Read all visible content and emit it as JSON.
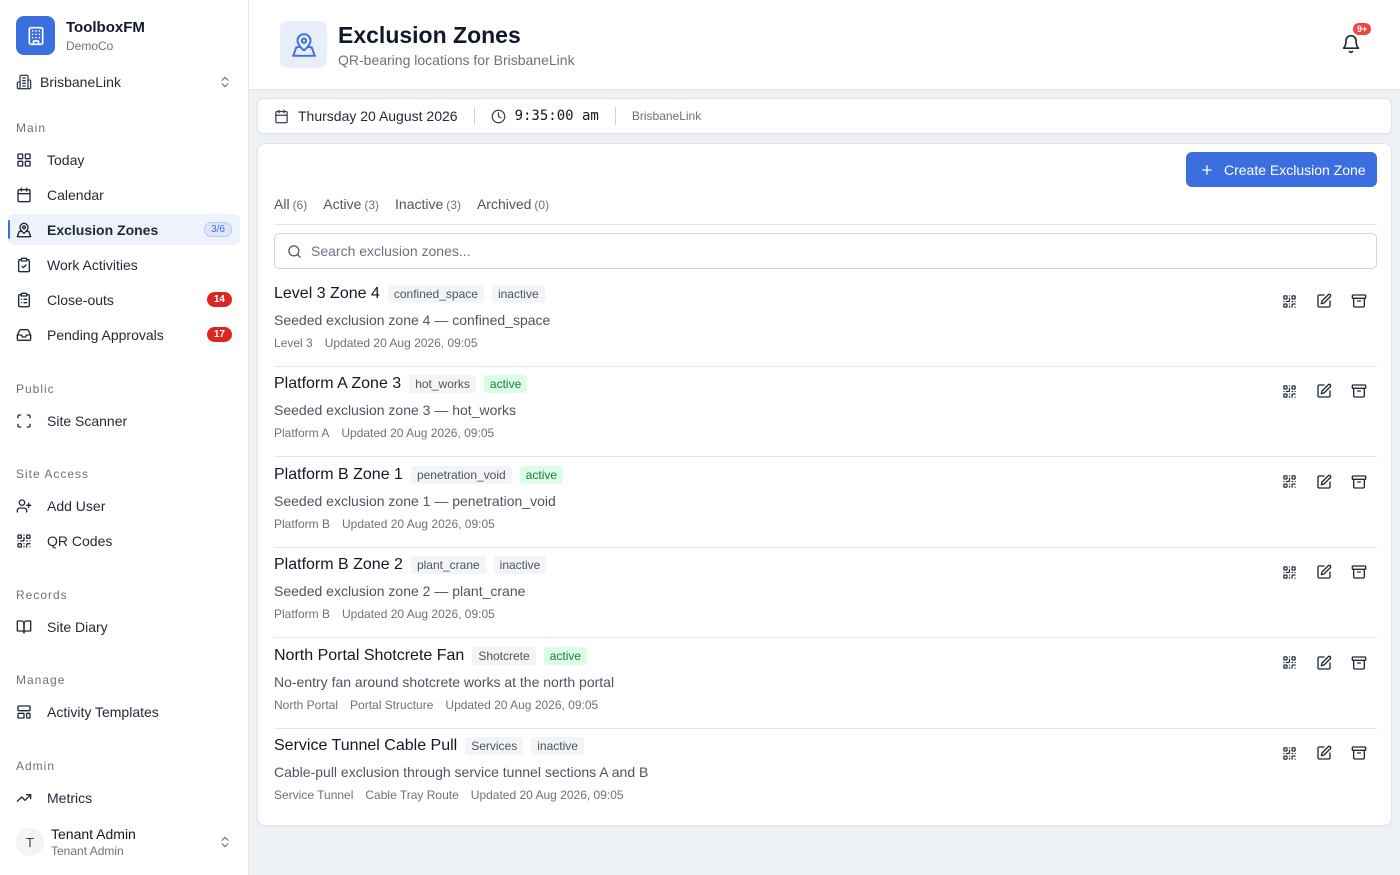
{
  "brand": {
    "name": "ToolboxFM",
    "org": "DemoCo"
  },
  "site_selector": {
    "value": "BrisbaneLink"
  },
  "nav": {
    "sections": [
      {
        "title": "Main"
      },
      {
        "title": "Public"
      },
      {
        "title": "Site Access"
      },
      {
        "title": "Records"
      },
      {
        "title": "Manage"
      },
      {
        "title": "Admin"
      }
    ],
    "items": [
      {
        "label": "Today",
        "icon": "grid-icon"
      },
      {
        "label": "Calendar",
        "icon": "calendar-icon"
      },
      {
        "label": "Exclusion Zones",
        "icon": "location-user-icon",
        "badge": "3/6",
        "active": true
      },
      {
        "label": "Work Activities",
        "icon": "clipboard-check-icon"
      },
      {
        "label": "Close-outs",
        "icon": "clipboard-list-icon",
        "badge": "14"
      },
      {
        "label": "Pending Approvals",
        "icon": "inbox-icon",
        "badge": "17"
      },
      {
        "label": "Site Scanner",
        "icon": "scan-icon"
      },
      {
        "label": "Add User",
        "icon": "user-plus-icon"
      },
      {
        "label": "QR Codes",
        "icon": "qr-code-icon"
      },
      {
        "label": "Site Diary",
        "icon": "book-icon"
      },
      {
        "label": "Activity Templates",
        "icon": "layout-template-icon"
      },
      {
        "label": "Metrics",
        "icon": "trending-up-icon"
      }
    ]
  },
  "user": {
    "initial": "T",
    "name": "Tenant Admin",
    "role": "Tenant Admin"
  },
  "header": {
    "title": "Exclusion Zones",
    "subtitle": "QR-bearing locations for BrisbaneLink",
    "notifications_badge": "9+"
  },
  "infobar": {
    "date": "Thursday 20 August 2026",
    "time": "9:35:00 am",
    "site": "BrisbaneLink"
  },
  "toolbar": {
    "create_label": "Create Exclusion Zone"
  },
  "tabs": [
    {
      "label": "All",
      "count": "(6)"
    },
    {
      "label": "Active",
      "count": "(3)"
    },
    {
      "label": "Inactive",
      "count": "(3)"
    },
    {
      "label": "Archived",
      "count": "(0)"
    }
  ],
  "search": {
    "placeholder": "Search exclusion zones..."
  },
  "zones": [
    {
      "name": "Level 3 Zone 4",
      "category": "confined_space",
      "status": "inactive",
      "description": "Seeded exclusion zone 4 — confined_space",
      "meta": [
        "Level 3",
        "Updated 20 Aug 2026, 09:05"
      ]
    },
    {
      "name": "Platform A Zone 3",
      "category": "hot_works",
      "status": "active",
      "description": "Seeded exclusion zone 3 — hot_works",
      "meta": [
        "Platform A",
        "Updated 20 Aug 2026, 09:05"
      ]
    },
    {
      "name": "Platform B Zone 1",
      "category": "penetration_void",
      "status": "active",
      "description": "Seeded exclusion zone 1 — penetration_void",
      "meta": [
        "Platform B",
        "Updated 20 Aug 2026, 09:05"
      ]
    },
    {
      "name": "Platform B Zone 2",
      "category": "plant_crane",
      "status": "inactive",
      "description": "Seeded exclusion zone 2 — plant_crane",
      "meta": [
        "Platform B",
        "Updated 20 Aug 2026, 09:05"
      ]
    },
    {
      "name": "North Portal Shotcrete Fan",
      "category": "Shotcrete",
      "status": "active",
      "description": "No-entry fan around shotcrete works at the north portal",
      "meta": [
        "North Portal",
        "Portal Structure",
        "Updated 20 Aug 2026, 09:05"
      ]
    },
    {
      "name": "Service Tunnel Cable Pull",
      "category": "Services",
      "status": "inactive",
      "description": "Cable-pull exclusion through service tunnel sections A and B",
      "meta": [
        "Service Tunnel",
        "Cable Tray Route",
        "Updated 20 Aug 2026, 09:05"
      ]
    }
  ],
  "colors": {
    "accent": "#3b6fe0",
    "danger": "#dc2626",
    "active_bg": "#dcfce7",
    "active_text": "#15803d"
  }
}
